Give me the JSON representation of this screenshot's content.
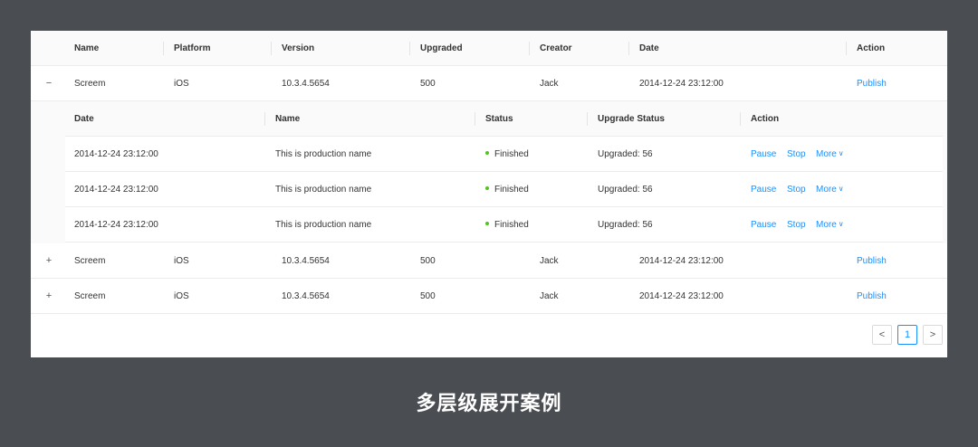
{
  "table": {
    "columns": [
      "Name",
      "Platform",
      "Version",
      "Upgraded",
      "Creator",
      "Date",
      "Action"
    ],
    "rows": [
      {
        "expander": "−",
        "name": "Screem",
        "platform": "iOS",
        "version": "10.3.4.5654",
        "upgraded": "500",
        "creator": "Jack",
        "date": "2014-12-24 23:12:00",
        "action": "Publish"
      },
      {
        "expander": "+",
        "name": "Screem",
        "platform": "iOS",
        "version": "10.3.4.5654",
        "upgraded": "500",
        "creator": "Jack",
        "date": "2014-12-24 23:12:00",
        "action": "Publish"
      },
      {
        "expander": "+",
        "name": "Screem",
        "platform": "iOS",
        "version": "10.3.4.5654",
        "upgraded": "500",
        "creator": "Jack",
        "date": "2014-12-24 23:12:00",
        "action": "Publish"
      }
    ]
  },
  "nested": {
    "columns": [
      "Date",
      "Name",
      "Status",
      "Upgrade Status",
      "Action"
    ],
    "rows": [
      {
        "date": "2014-12-24 23:12:00",
        "name": "This is production name",
        "status": "Finished",
        "upgrade_status": "Upgraded: 56",
        "pause": "Pause",
        "stop": "Stop",
        "more": "More"
      },
      {
        "date": "2014-12-24 23:12:00",
        "name": "This is production name",
        "status": "Finished",
        "upgrade_status": "Upgraded: 56",
        "pause": "Pause",
        "stop": "Stop",
        "more": "More"
      },
      {
        "date": "2014-12-24 23:12:00",
        "name": "This is production name",
        "status": "Finished",
        "upgrade_status": "Upgraded: 56",
        "pause": "Pause",
        "stop": "Stop",
        "more": "More"
      }
    ]
  },
  "pagination": {
    "prev": "<",
    "current": "1",
    "next": ">"
  },
  "icons": {
    "status_dot": "status-dot-icon",
    "chevron": "chevron-down-icon"
  },
  "colors": {
    "link": "#1890ff",
    "status_success": "#52c41a",
    "background": "#4a4d52"
  },
  "caption": "多层级展开案例"
}
